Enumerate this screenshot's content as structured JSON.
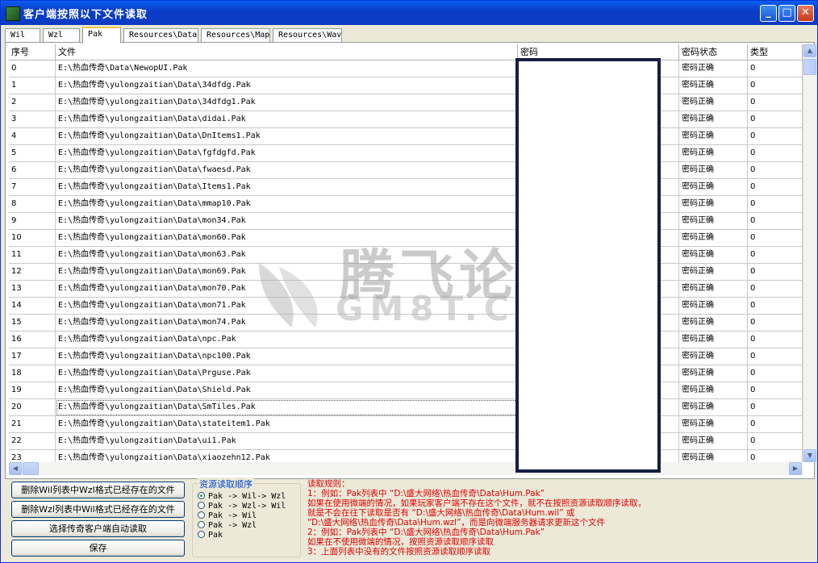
{
  "window": {
    "title": "客户端按照以下文件读取"
  },
  "tabs": [
    {
      "label": "Wil"
    },
    {
      "label": "Wzl"
    },
    {
      "label": "Pak"
    },
    {
      "label": "Resources\\Data"
    },
    {
      "label": "Resources\\Map"
    },
    {
      "label": "Resources\\Wav"
    }
  ],
  "table": {
    "columns": [
      "序号",
      "文件",
      "密码",
      "密码状态",
      "类型"
    ],
    "rows": [
      {
        "index": "0",
        "file": "E:\\热血传奇\\Data\\NewopUI.Pak",
        "status": "密码正确",
        "type": "0"
      },
      {
        "index": "1",
        "file": "E:\\热血传奇\\yulongzaitian\\Data\\34dfdg.Pak",
        "status": "密码正确",
        "type": "0"
      },
      {
        "index": "2",
        "file": "E:\\热血传奇\\yulongzaitian\\Data\\34dfdg1.Pak",
        "status": "密码正确",
        "type": "0"
      },
      {
        "index": "3",
        "file": "E:\\热血传奇\\yulongzaitian\\Data\\didai.Pak",
        "status": "密码正确",
        "type": "0"
      },
      {
        "index": "4",
        "file": "E:\\热血传奇\\yulongzaitian\\Data\\DnItems1.Pak",
        "status": "密码正确",
        "type": "0"
      },
      {
        "index": "5",
        "file": "E:\\热血传奇\\yulongzaitian\\Data\\fgfdgfd.Pak",
        "status": "密码正确",
        "type": "0"
      },
      {
        "index": "6",
        "file": "E:\\热血传奇\\yulongzaitian\\Data\\fwaesd.Pak",
        "status": "密码正确",
        "type": "0"
      },
      {
        "index": "7",
        "file": "E:\\热血传奇\\yulongzaitian\\Data\\Items1.Pak",
        "status": "密码正确",
        "type": "0"
      },
      {
        "index": "8",
        "file": "E:\\热血传奇\\yulongzaitian\\Data\\mmap10.Pak",
        "status": "密码正确",
        "type": "0"
      },
      {
        "index": "9",
        "file": "E:\\热血传奇\\yulongzaitian\\Data\\mon34.Pak",
        "status": "密码正确",
        "type": "0"
      },
      {
        "index": "10",
        "file": "E:\\热血传奇\\yulongzaitian\\Data\\mon60.Pak",
        "status": "密码正确",
        "type": "0"
      },
      {
        "index": "11",
        "file": "E:\\热血传奇\\yulongzaitian\\Data\\mon63.Pak",
        "status": "密码正确",
        "type": "0"
      },
      {
        "index": "12",
        "file": "E:\\热血传奇\\yulongzaitian\\Data\\mon69.Pak",
        "status": "密码正确",
        "type": "0"
      },
      {
        "index": "13",
        "file": "E:\\热血传奇\\yulongzaitian\\Data\\mon70.Pak",
        "status": "密码正确",
        "type": "0"
      },
      {
        "index": "14",
        "file": "E:\\热血传奇\\yulongzaitian\\Data\\mon71.Pak",
        "status": "密码正确",
        "type": "0"
      },
      {
        "index": "15",
        "file": "E:\\热血传奇\\yulongzaitian\\Data\\mon74.Pak",
        "status": "密码正确",
        "type": "0"
      },
      {
        "index": "16",
        "file": "E:\\热血传奇\\yulongzaitian\\Data\\npc.Pak",
        "status": "密码正确",
        "type": "0"
      },
      {
        "index": "17",
        "file": "E:\\热血传奇\\yulongzaitian\\Data\\npc100.Pak",
        "status": "密码正确",
        "type": "0"
      },
      {
        "index": "18",
        "file": "E:\\热血传奇\\yulongzaitian\\Data\\Prguse.Pak",
        "status": "密码正确",
        "type": "0"
      },
      {
        "index": "19",
        "file": "E:\\热血传奇\\yulongzaitian\\Data\\Shield.Pak",
        "status": "密码正确",
        "type": "0"
      },
      {
        "index": "20",
        "file": "E:\\热血传奇\\yulongzaitian\\Data\\SmTiles.Pak",
        "status": "密码正确",
        "type": "0"
      },
      {
        "index": "21",
        "file": "E:\\热血传奇\\yulongzaitian\\Data\\stateitem1.Pak",
        "status": "密码正确",
        "type": "0"
      },
      {
        "index": "22",
        "file": "E:\\热血传奇\\yulongzaitian\\Data\\ui1.Pak",
        "status": "密码正确",
        "type": "0"
      },
      {
        "index": "23",
        "file": "E:\\热血传奇\\yulongzaitian\\Data\\xiaozehn12.Pak",
        "status": "密码正确",
        "type": "0"
      }
    ]
  },
  "watermark": {
    "text_cn": "腾飞论坛",
    "text_en": "GM8T.COM"
  },
  "buttons": {
    "delete_wil": "删除Wil列表中Wzl格式已经存在的文件",
    "delete_wzl": "删除Wzl列表中Wil格式已经存在的文件",
    "auto_read": "选择传奇客户端自动读取",
    "save": "保存"
  },
  "resource_order": {
    "title": "资源读取顺序",
    "options": [
      {
        "label": "Pak -> Wil-> Wzl",
        "selected": true
      },
      {
        "label": "Pak -> Wzl-> Wil",
        "selected": false
      },
      {
        "label": "Pak -> Wil",
        "selected": false
      },
      {
        "label": "Pak -> Wzl",
        "selected": false
      },
      {
        "label": "Pak",
        "selected": false
      }
    ]
  },
  "rules": {
    "lines": [
      "读取规则：",
      "1：例如：Pak列表中 “D:\\盛大网络\\热血传奇\\Data\\Hum.Pak”",
      "    如果在使用微端的情况，如果玩家客户端不存在这个文件，就不在按照资源读取顺序读取，",
      "    就是不会在往下读取是否有 “D:\\盛大网络\\热血传奇\\Data\\Hum.wil” 或",
      "    “D:\\盛大网络\\热血传奇\\Data\\Hum.wzl”，而是向微端服务器请求更新这个文件",
      "2：例如：Pak列表中 “D:\\盛大网络\\热血传奇\\Data\\Hum.Pak”",
      "    如果在不使用微端的情况，按照资源读取顺序读取",
      "3：上面列表中没有的文件按照资源读取顺序读取"
    ]
  },
  "colors": {
    "title_bar": "#0b3bc1",
    "rules_text": "#e00000",
    "group_title": "#0046d5",
    "password_box_border": "#141e42"
  }
}
